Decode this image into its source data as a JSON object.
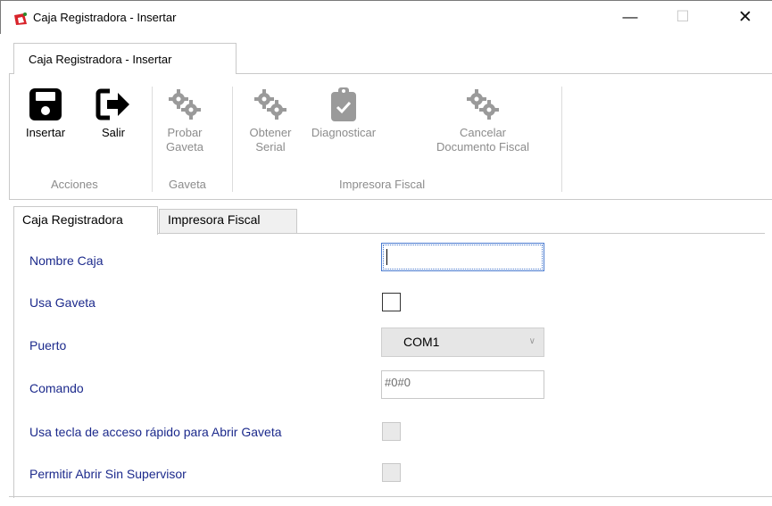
{
  "window": {
    "title": "Caja Registradora - Insertar",
    "minimize_glyph": "—",
    "maximize_glyph": "☐",
    "close_glyph": "✕"
  },
  "ribbon": {
    "tab_label": "Caja Registradora - Insertar",
    "groups": {
      "acciones": "Acciones",
      "gaveta": "Gaveta",
      "impresora": "Impresora Fiscal"
    },
    "buttons": {
      "insertar": "Insertar",
      "salir": "Salir",
      "probar_1": "Probar",
      "probar_2": "Gaveta",
      "serial_1": "Obtener",
      "serial_2": "Serial",
      "diagnosticar": "Diagnosticar",
      "cancelar_1": "Cancelar",
      "cancelar_2": "Documento Fiscal"
    }
  },
  "tabs": {
    "caja": "Caja Registradora",
    "impresora": "Impresora Fiscal"
  },
  "form": {
    "nombre_label": "Nombre Caja",
    "nombre_value": "",
    "usa_gaveta_label": "Usa Gaveta",
    "puerto_label": "Puerto",
    "puerto_value": "COM1",
    "comando_label": "Comando",
    "comando_value": "#0#0",
    "tecla_label": "Usa tecla de acceso rápido para Abrir Gaveta",
    "permitir_label": "Permitir Abrir Sin Supervisor"
  },
  "icons": {
    "insertar": "save-icon",
    "salir": "exit-icon",
    "gear": "gears-icon",
    "diagnosticar": "clipboard-check-icon"
  },
  "colors": {
    "label_blue": "#1c2a8c",
    "disabled_gray": "#8c8c8c"
  }
}
